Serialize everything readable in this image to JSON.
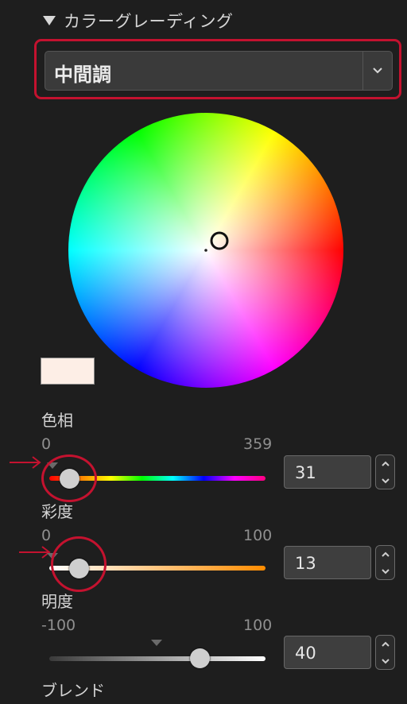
{
  "section": {
    "title": "カラーグレーディング"
  },
  "preset": {
    "value": "中間調"
  },
  "hue": {
    "label": "色相",
    "min": "0",
    "max": "359",
    "value": "31",
    "position": 0.086
  },
  "saturation": {
    "label": "彩度",
    "min": "0",
    "max": "100",
    "value": "13",
    "position": 0.13
  },
  "lightness": {
    "label": "明度",
    "min": "-100",
    "max": "100",
    "value": "40",
    "position": 0.7
  },
  "blend": {
    "label": "ブレンド"
  },
  "swatch": {
    "color": "#fdeee6"
  },
  "colors": {
    "highlight": "#c4122f",
    "background": "#1e1e1e"
  }
}
